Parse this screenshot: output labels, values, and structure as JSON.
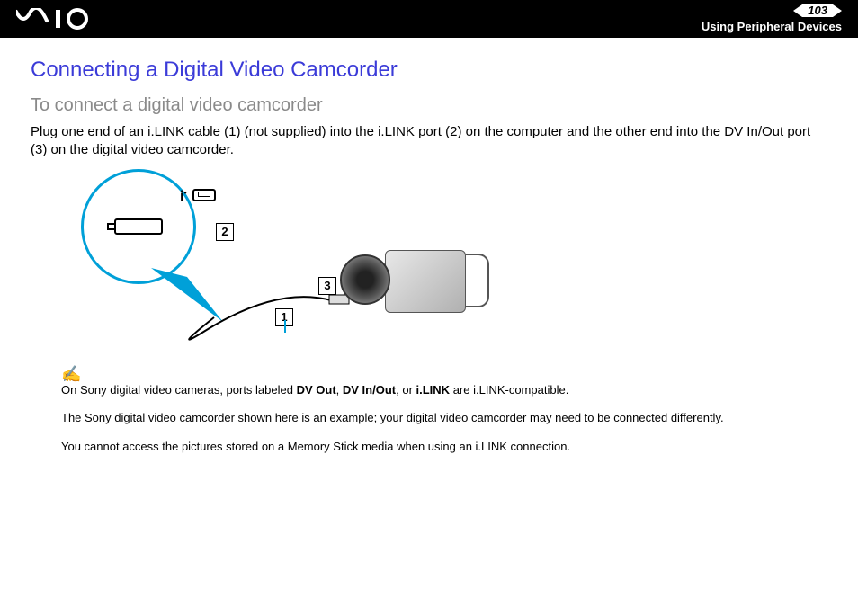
{
  "header": {
    "page_number": "103",
    "breadcrumb": "Using Peripheral Devices"
  },
  "content": {
    "title": "Connecting a Digital Video Camcorder",
    "subtitle": "To connect a digital video camcorder",
    "body": "Plug one end of an i.LINK cable (1) (not supplied) into the i.LINK port (2) on the computer and the other end into the DV In/Out port (3) on the digital video camcorder."
  },
  "diagram": {
    "labels": {
      "1": "1",
      "2": "2",
      "3": "3"
    }
  },
  "notes": {
    "n1_pre": "On Sony digital video cameras, ports labeled ",
    "n1_b1": "DV Out",
    "n1_s1": ", ",
    "n1_b2": "DV In/Out",
    "n1_s2": ", or ",
    "n1_b3": "i.LINK",
    "n1_post": " are i.LINK-compatible.",
    "n2": "The Sony digital video camcorder shown here is an example; your digital video camcorder may need to be connected differently.",
    "n3": "You cannot access the pictures stored on a Memory Stick media when using an i.LINK connection."
  }
}
